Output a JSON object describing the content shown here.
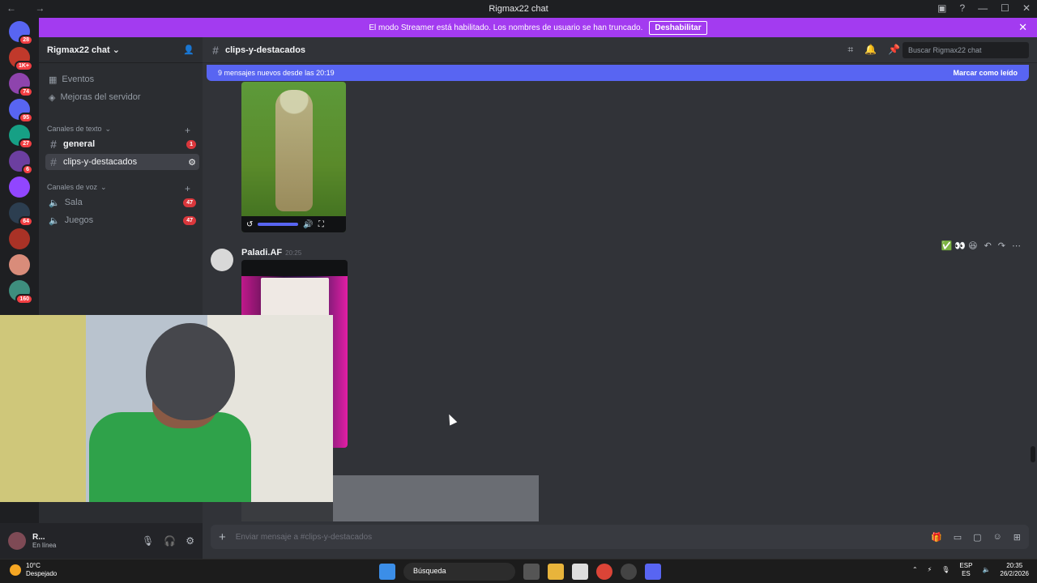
{
  "window": {
    "title": "Rigmax22 chat",
    "nav": "← →"
  },
  "banner": {
    "text": "El modo Streamer está habilitado. Los nombres de usuario se han truncado.",
    "button": "Deshabilitar"
  },
  "guilds": [
    {
      "badge": "28",
      "color": "#5865f2"
    },
    {
      "badge": "1K+",
      "color": "#c0392b"
    },
    {
      "badge": "74",
      "color": "#8e44ad"
    },
    {
      "badge": "95",
      "color": "#5865f2"
    },
    {
      "badge": "27",
      "color": "#16a085"
    },
    {
      "badge": "6",
      "color": "#6c3fa0"
    },
    {
      "badge": "",
      "color": "#9146ff"
    },
    {
      "badge": "64",
      "color": "#2c3e50"
    },
    {
      "badge": "",
      "color": "#a93226"
    },
    {
      "badge": "",
      "color": "#d98c7a"
    },
    {
      "badge": "160",
      "color": "#3e8e7e"
    }
  ],
  "server": {
    "name": "Rigmax22 chat"
  },
  "sidebar": {
    "events": "Eventos",
    "boosts": "Mejoras del servidor",
    "text_category": "Canales de texto",
    "voice_category": "Canales de voz",
    "channels": [
      {
        "name": "general",
        "badge": "1"
      },
      {
        "name": "clips-y-destacados",
        "badge": ""
      }
    ],
    "voice": [
      {
        "name": "Sala",
        "badge": "47"
      },
      {
        "name": "Juegos",
        "badge": "47"
      }
    ]
  },
  "channel": {
    "name": "clips-y-destacados",
    "search_placeholder": "Buscar Rigmax22 chat"
  },
  "new_messages": {
    "text": "9 mensajes nuevos desde las 20:19",
    "action": "Marcar como leído"
  },
  "message": {
    "author": "Paladi.AF",
    "time": "20:25",
    "reactions": "✅ 👀 😆"
  },
  "composer": {
    "placeholder": "Enviar mensaje a #clips-y-destacados"
  },
  "user": {
    "name": "R...",
    "status": "En línea"
  },
  "taskbar": {
    "temp": "10°C",
    "weather": "Despejado",
    "search": "Búsqueda",
    "lang1": "ESP",
    "lang2": "ES",
    "time": "20:35",
    "date": "26/2/2026"
  }
}
